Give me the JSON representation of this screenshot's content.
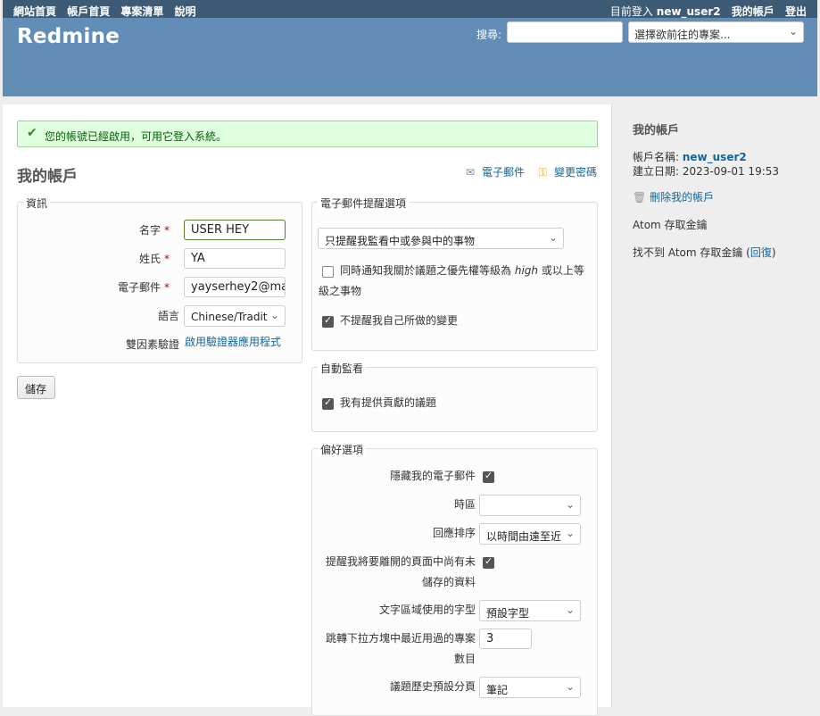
{
  "top_menu": {
    "left": [
      "網站首頁",
      "帳戶首頁",
      "專案清單",
      "說明"
    ],
    "logged_as_prefix": "目前登入",
    "logged_user": "new_user2",
    "my_account": "我的帳戶",
    "logout": "登出"
  },
  "header": {
    "title": "Redmine",
    "search_label": "搜尋:",
    "search_placeholder": "",
    "project_jump": "選擇欲前往的專案..."
  },
  "flash": {
    "message": "您的帳號已經啟用，可用它登入系統。"
  },
  "page": {
    "title": "我的帳戶",
    "email_link": "電子郵件",
    "change_password_link": "變更密碼",
    "save_button": "儲存"
  },
  "info": {
    "legend": "資訊",
    "firstname_label": "名字",
    "firstname_value": "USER HEY",
    "lastname_label": "姓氏",
    "lastname_value": "YA",
    "email_label": "電子郵件",
    "email_value": "yayserhey2@ma",
    "language_label": "語言",
    "language_value": "Chinese/Tradit",
    "twofa_label": "雙因素驗證",
    "twofa_link": "啟用驗證器應用程式",
    "required_mark": "*"
  },
  "mail_notification": {
    "legend": "電子郵件提醒選項",
    "option": "只提醒我監看中或參與中的事物",
    "high_priority_prefix": "同時通知我關於議題之優先權等級為",
    "high_priority_word": "high",
    "high_priority_suffix": "或以上等",
    "high_priority_line2": "級之事物",
    "high_priority_checked": false,
    "no_self_notified": "不提醒我自己所做的變更",
    "no_self_notified_checked": true
  },
  "auto_watch": {
    "legend": "自動監看",
    "option": "我有提供貢獻的議題",
    "checked": true
  },
  "preferences": {
    "legend": "偏好選項",
    "hide_mail_label": "隱藏我的電子郵件",
    "hide_mail_checked": true,
    "timezone_label": "時區",
    "timezone_value": "",
    "comments_sorting_label": "回應排序",
    "comments_sorting_value": "以時間由遠至近",
    "warn_unsaved_line1": "提醒我將要離開的頁面中尚有未",
    "warn_unsaved_line2": "儲存的資料",
    "warn_unsaved_checked": true,
    "textarea_font_label": "文字區域使用的字型",
    "textarea_font_value": "預設字型",
    "recent_projects_line1": "跳轉下拉方塊中最近用過的專案",
    "recent_projects_line2": "數目",
    "recent_projects_value": "3",
    "default_tab_label": "議題歷史預設分頁",
    "default_tab_value": "筆記"
  },
  "sidebar": {
    "title": "我的帳戶",
    "login_label": "帳戶名稱:",
    "login_value": "new_user2",
    "created_label": "建立日期:",
    "created_value": "2023-09-01 19:53",
    "delete_account": "刪除我的帳戶",
    "atom_title": "Atom 存取金鑰",
    "atom_missing_prefix": "找不到 Atom 存取金鑰 (",
    "atom_reset": "回復",
    "atom_missing_suffix": ")"
  }
}
